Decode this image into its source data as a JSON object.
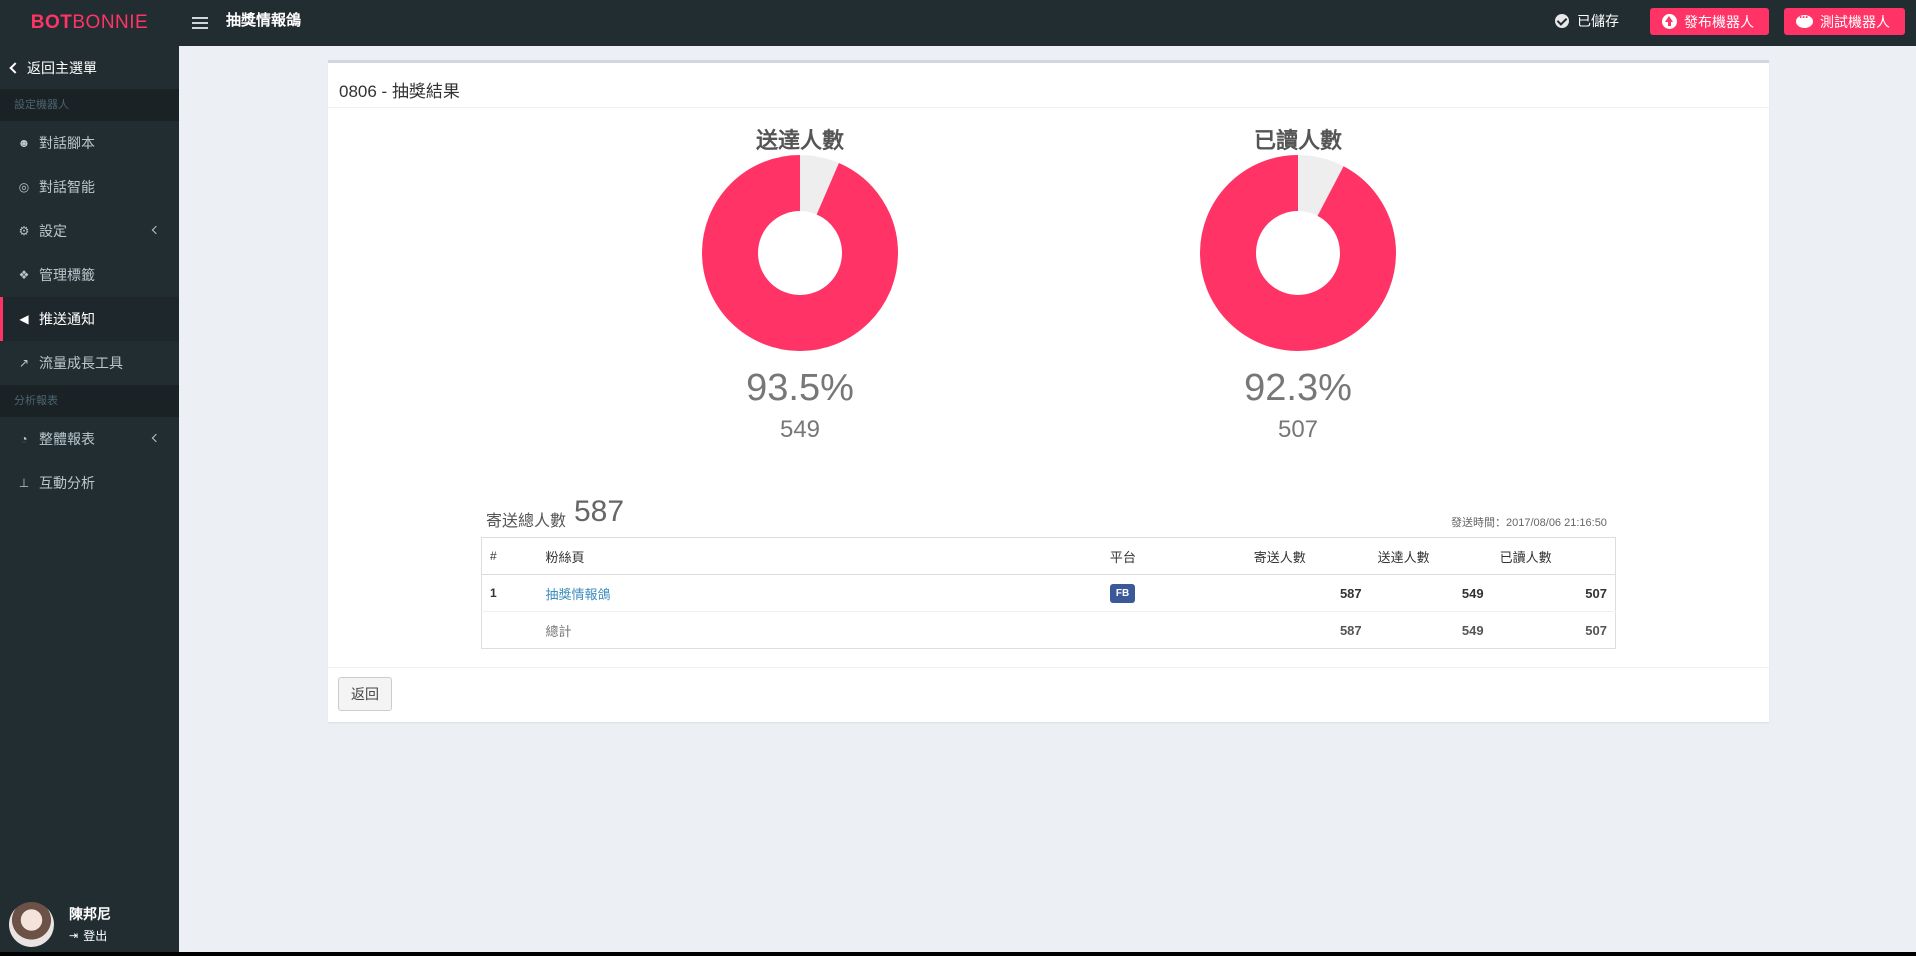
{
  "header": {
    "logo_bold": "BOT",
    "logo_light": "BONNIE",
    "bot_name": "抽獎情報鴿",
    "saved_status": "已儲存",
    "publish_label": "發布機器人",
    "test_label": "測試機器人",
    "accent_color": "#ff3366"
  },
  "sidebar": {
    "back_label": "返回主選單",
    "section_bot": "設定機器人",
    "section_report": "分析報表",
    "items": [
      {
        "label": "對話腳本",
        "icon": "reddit-icon"
      },
      {
        "label": "對話智能",
        "icon": "target-icon"
      },
      {
        "label": "設定",
        "icon": "gear-icon"
      },
      {
        "label": "管理標籤",
        "icon": "tags-icon"
      },
      {
        "label": "推送通知",
        "icon": "bullhorn-icon",
        "active": true
      },
      {
        "label": "流量成長工具",
        "icon": "line-chart-icon"
      },
      {
        "label": "整體報表",
        "icon": "dashboard-icon"
      },
      {
        "label": "互動分析",
        "icon": "sitemap-icon"
      }
    ],
    "user": {
      "name": "陳邦尼",
      "logout": "登出"
    }
  },
  "panel": {
    "title_prefix": "0806 - ",
    "title_main": "抽獎結果",
    "total_label": "寄送總人數",
    "total_value": "587",
    "send_time": "發送時間：2017/08/06 21:16:50",
    "back_button": "返回"
  },
  "charts": [
    {
      "title": "送達人數",
      "percent_label": "93.5%",
      "count": "549",
      "percent": 93.5
    },
    {
      "title": "已讀人數",
      "percent_label": "92.3%",
      "count": "507",
      "percent": 92.3
    }
  ],
  "table": {
    "headers": [
      "#",
      "粉絲頁",
      "平台",
      "寄送人數",
      "送達人數",
      "已讀人數"
    ],
    "rows": [
      {
        "index": "1",
        "fanpage": "抽獎情報鴿",
        "platform": "FB",
        "sent": "587",
        "delivered": "549",
        "read": "507"
      }
    ],
    "total": {
      "label": "總計",
      "sent": "587",
      "delivered": "549",
      "read": "507"
    }
  }
}
